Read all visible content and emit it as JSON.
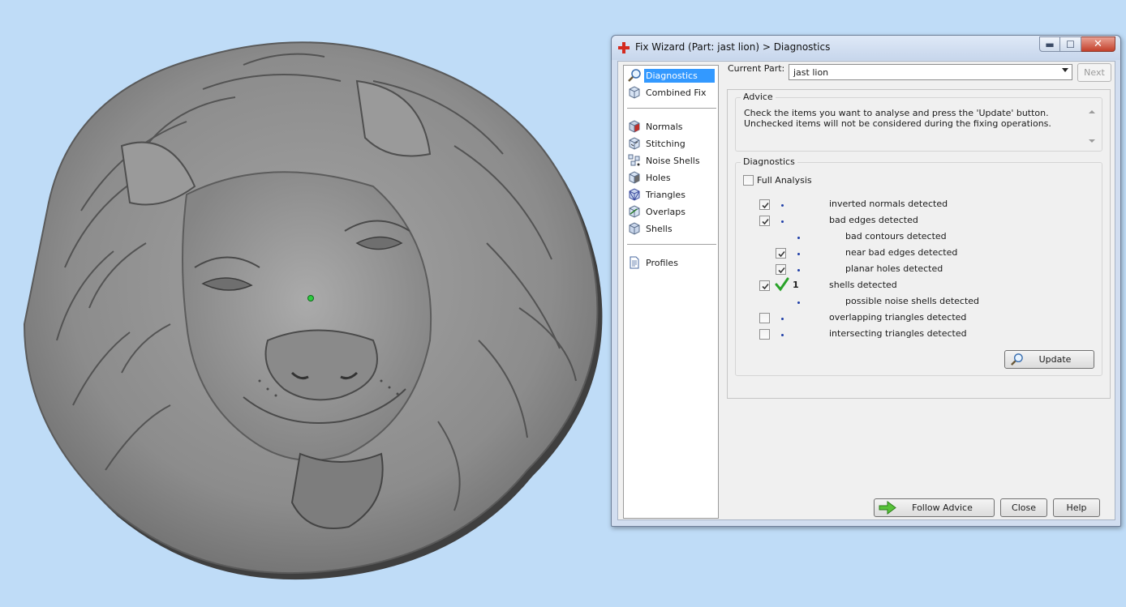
{
  "viewport": {
    "model_description_icon": "lion-head-relief-icon"
  },
  "window": {
    "title": "Fix Wizard (Part: jast lion) > Diagnostics",
    "controls": {
      "minimize": "▬",
      "maximize": "☐",
      "close": "✕"
    }
  },
  "nav": {
    "items": [
      {
        "label": "Diagnostics",
        "icon": "magnifier-icon",
        "selected": true
      },
      {
        "label": "Combined Fix",
        "icon": "cube-icon"
      },
      {
        "label": "Normals",
        "icon": "normals-cube-icon"
      },
      {
        "label": "Stitching",
        "icon": "stitching-cube-icon"
      },
      {
        "label": "Noise Shells",
        "icon": "noise-shells-icon"
      },
      {
        "label": "Holes",
        "icon": "holes-cube-icon"
      },
      {
        "label": "Triangles",
        "icon": "triangles-cube-icon"
      },
      {
        "label": "Overlaps",
        "icon": "overlaps-cube-icon"
      },
      {
        "label": "Shells",
        "icon": "shells-cube-icon"
      },
      {
        "label": "Profiles",
        "icon": "document-icon"
      }
    ]
  },
  "part": {
    "label": "Current Part:",
    "value": "jast lion"
  },
  "next_label": "Next",
  "advice": {
    "title": "Advice",
    "text": "Check the items you want to analyse and press the 'Update' button. Unchecked items will not be considered during the fixing operations."
  },
  "diagnostics": {
    "title": "Diagnostics",
    "full_analysis": {
      "label": "Full Analysis",
      "checked": false
    },
    "rows": [
      {
        "label": "inverted normals detected",
        "checked": true,
        "indent": 0,
        "count": ""
      },
      {
        "label": "bad edges detected",
        "checked": true,
        "indent": 0,
        "count": ""
      },
      {
        "label": "bad contours detected",
        "checked": null,
        "indent": 1,
        "count": ""
      },
      {
        "label": "near bad edges detected",
        "checked": true,
        "indent": 1,
        "count": ""
      },
      {
        "label": "planar holes detected",
        "checked": true,
        "indent": 1,
        "count": ""
      },
      {
        "label": "shells detected",
        "checked": true,
        "indent": 0,
        "count": "1",
        "ok": true
      },
      {
        "label": "possible noise shells detected",
        "checked": null,
        "indent": 1,
        "count": ""
      },
      {
        "label": "overlapping triangles detected",
        "checked": false,
        "indent": 0,
        "count": ""
      },
      {
        "label": "intersecting triangles detected",
        "checked": false,
        "indent": 0,
        "count": ""
      }
    ],
    "update_label": "Update"
  },
  "footer": {
    "follow_advice": "Follow Advice",
    "close": "Close",
    "help": "Help"
  },
  "colors": {
    "background": "#bfdcf7",
    "model": "#8f8f8f",
    "selection": "#3399ff",
    "check_ok": "#2aa32a"
  }
}
